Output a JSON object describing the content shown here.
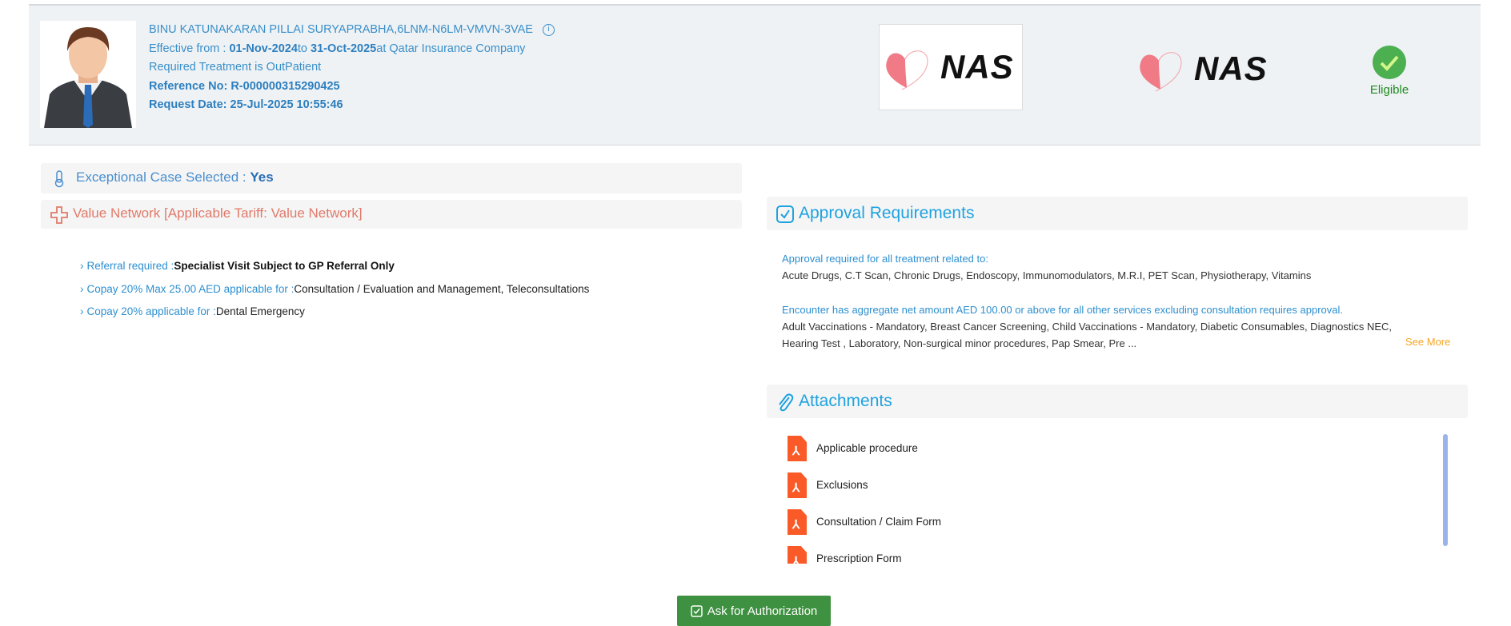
{
  "patient": {
    "name_line": "BINU KATUNAKARAN PILLAI SURYAPRABHA,6LNM-N6LM-VMVN-3VAE",
    "effective_label": "Effective from : ",
    "effective_from": "01-Nov-2024",
    "to_label": "to ",
    "effective_to": "31-Oct-2025",
    "insurer_text": "at Qatar Insurance Company",
    "treatment": "Required Treatment is OutPatient",
    "reference": "Reference No: R-000000315290425",
    "request_date": "Request Date: 25-Jul-2025 10:55:46"
  },
  "logos": {
    "primary": "NAS",
    "secondary": "NAS"
  },
  "status": {
    "label": "Eligible",
    "color": "#4caf50"
  },
  "exceptional": {
    "label": "Exceptional Case Selected : ",
    "value": "Yes"
  },
  "network": {
    "label": "Value Network [Applicable Tariff: Value Network]"
  },
  "benefits": [
    {
      "label": "Referral required :",
      "value": "Specialist Visit Subject to GP Referral Only",
      "bold": true
    },
    {
      "label": "Copay 20% Max 25.00 AED applicable for :",
      "value": "Consultation / Evaluation and Management, Teleconsultations"
    },
    {
      "label": "Copay 20% applicable for :",
      "value": "Dental Emergency"
    }
  ],
  "approval": {
    "title": "Approval Requirements",
    "blocks": [
      {
        "heading": "Approval required for all treatment related to:",
        "text": "Acute Drugs, C.T Scan, Chronic Drugs, Endoscopy, Immunomodulators, M.R.I, PET Scan, Physiotherapy, Vitamins"
      },
      {
        "heading": "Encounter has aggregate net amount AED 100.00 or above for all other services excluding consultation requires approval.",
        "text": "Adult Vaccinations - Mandatory, Breast Cancer Screening, Child Vaccinations - Mandatory, Diabetic Consumables, Diagnostics NEC, Hearing Test , Laboratory, Non-surgical minor procedures, Pap Smear, Pre ..."
      }
    ],
    "see_more": "See More"
  },
  "attachments": {
    "title": "Attachments",
    "items": [
      "Applicable procedure",
      "Exclusions",
      "Consultation / Claim Form",
      "Prescription Form"
    ]
  },
  "actions": {
    "ask_auth": "Ask for Authorization"
  }
}
